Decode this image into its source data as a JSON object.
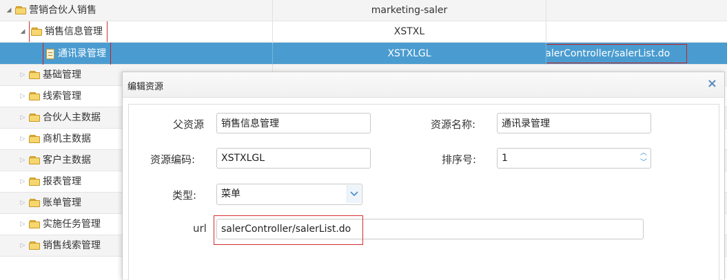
{
  "tree": {
    "rows": [
      {
        "label": "营销合伙人销售",
        "code": "marketing-saler",
        "url": ""
      },
      {
        "label": "销售信息管理",
        "code": "XSTXL",
        "url": ""
      },
      {
        "label": "通讯录管理",
        "code": "XSTXLGL",
        "url": "salerController/salerList.do"
      },
      {
        "label": "基础管理"
      },
      {
        "label": "线索管理"
      },
      {
        "label": "合伙人主数据"
      },
      {
        "label": "商机主数据"
      },
      {
        "label": "客户主数据"
      },
      {
        "label": "报表管理"
      },
      {
        "label": "账单管理"
      },
      {
        "label": "实施任务管理"
      },
      {
        "label": "销售线索管理"
      }
    ]
  },
  "dialog": {
    "title": "编辑资源",
    "close_icon": "×",
    "fields": {
      "parent_label": "父资源",
      "parent_value": "销售信息管理",
      "name_label": "资源名称:",
      "name_value": "通讯录管理",
      "code_label": "资源编码:",
      "code_value": "XSTXLGL",
      "sort_label": "排序号:",
      "sort_value": "1",
      "type_label": "类型:",
      "type_value": "菜单",
      "url_label": "url",
      "url_value": "salerController/salerList.do"
    }
  },
  "colors": {
    "selected_row": "#4a9cd0",
    "highlight_border": "#d22d2d",
    "folder": "#f6d66f"
  }
}
